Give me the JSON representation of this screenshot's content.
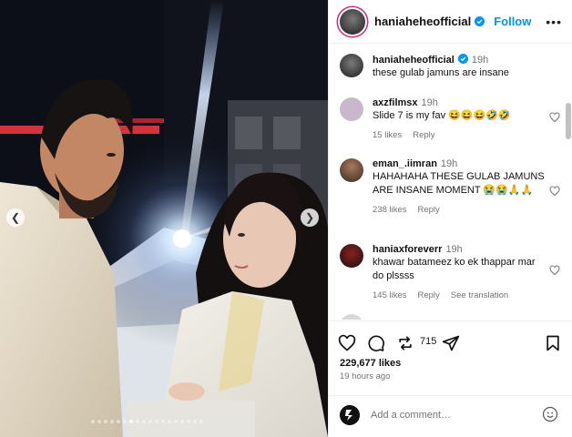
{
  "post": {
    "username": "haniaheheofficial",
    "follow_label": "Follow",
    "more_label": "•••"
  },
  "caption": {
    "username": "haniaheheofficial",
    "time": "19h",
    "text": "these gulab jamuns are insane"
  },
  "comments": [
    {
      "username": "axzfilmsx",
      "time": "19h",
      "text": "Slide 7 is my fav 😆😆😆🤣🤣",
      "likes": "15 likes",
      "reply": "Reply",
      "translate": ""
    },
    {
      "username": "eman_.iimran",
      "time": "19h",
      "text": "HAHAHAHA THESE GULAB JAMUNS ARE INSANE MOMENT 😭😭🙏🙏",
      "likes": "238 likes",
      "reply": "Reply",
      "translate": ""
    },
    {
      "username": "haniaxforeverr",
      "time": "19h",
      "text": "khawar batameez ko ek thappar mar do plssss",
      "likes": "145 likes",
      "reply": "Reply",
      "translate": "See translation"
    }
  ],
  "actions": {
    "repost_count": "715",
    "likes": "229,677 likes",
    "posted_ago": "19 hours ago"
  },
  "add_comment": {
    "placeholder": "Add a comment…"
  },
  "carousel": {
    "slide_count": 18,
    "active_slide": 7
  },
  "colors": {
    "accent": "#0095f6",
    "muted": "#737373",
    "verified": "#0095f6",
    "story_ring": "#d8287c"
  },
  "icons": {
    "like": "heart-icon",
    "comment": "comment-icon",
    "repost": "repost-icon",
    "share": "share-icon",
    "save": "bookmark-icon",
    "emoji": "emoji-icon",
    "verified": "verified-badge-icon"
  }
}
